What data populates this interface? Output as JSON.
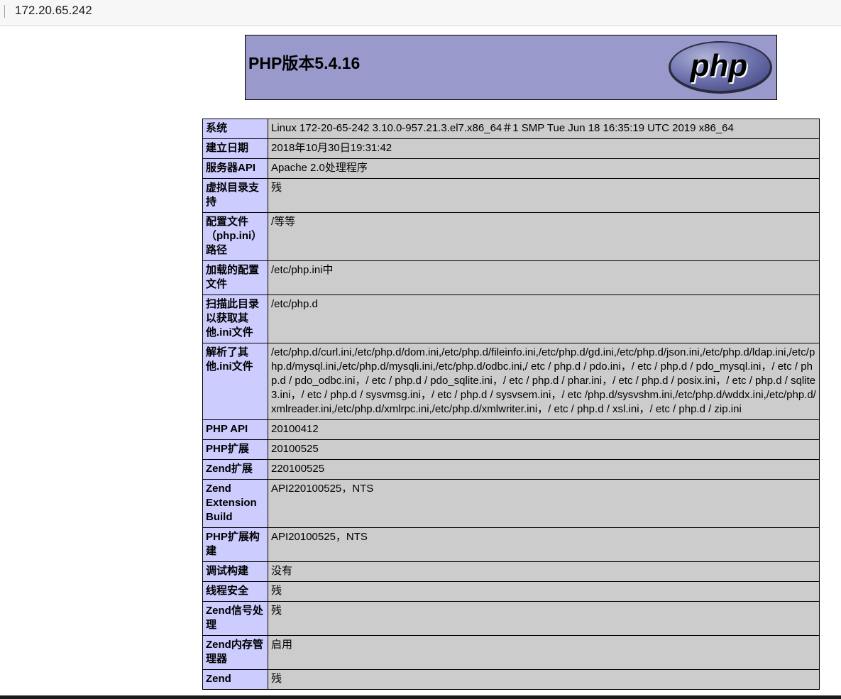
{
  "browser": {
    "url": "172.20.65.242"
  },
  "header": {
    "title": "PHP版本5.4.16",
    "logo_text": "php"
  },
  "rows": [
    {
      "key": "系统",
      "value": "Linux 172-20-65-242 3.10.0-957.21.3.el7.x86_64＃1 SMP Tue Jun 18 16:35:19 UTC 2019 x86_64"
    },
    {
      "key": "建立日期",
      "value": "2018年10月30日19:31:42"
    },
    {
      "key": "服务器API",
      "value": "Apache 2.0处理程序"
    },
    {
      "key": "虚拟目录支持",
      "value": "残"
    },
    {
      "key": "配置文件（php.ini）路径",
      "value": "/等等"
    },
    {
      "key": "加载的配置文件",
      "value": "/etc/php.ini中"
    },
    {
      "key": "扫描此目录以获取其他.ini文件",
      "value": "/etc/php.d"
    },
    {
      "key": "解析了其他.ini文件",
      "value": "/etc/php.d/curl.ini,/etc/php.d/dom.ini,/etc/php.d/fileinfo.ini,/etc/php.d/gd.ini,/etc/php.d/json.ini,/etc/php.d/ldap.ini,/etc/php.d/mysql.ini,/etc/php.d/mysqli.ini,/etc/php.d/odbc.ini,/ etc / php.d / pdo.ini，/ etc / php.d / pdo_mysql.ini，/ etc / php.d / pdo_odbc.ini，/ etc / php.d / pdo_sqlite.ini，/ etc / php.d / phar.ini，/ etc / php.d / posix.ini，/ etc / php.d / sqlite3.ini，/ etc / php.d / sysvmsg.ini，/ etc / php.d / sysvsem.ini，/ etc /php.d/sysvshm.ini,/etc/php.d/wddx.ini,/etc/php.d/xmlreader.ini,/etc/php.d/xmlrpc.ini,/etc/php.d/xmlwriter.ini，/ etc / php.d / xsl.ini，/ etc / php.d / zip.ini"
    },
    {
      "key": "PHP API",
      "value": "20100412"
    },
    {
      "key": "PHP扩展",
      "value": "20100525"
    },
    {
      "key": "Zend扩展",
      "value": "220100525"
    },
    {
      "key": "Zend Extension Build",
      "value": "API220100525，NTS"
    },
    {
      "key": "PHP扩展构建",
      "value": "API20100525，NTS"
    },
    {
      "key": "调试构建",
      "value": "没有"
    },
    {
      "key": "线程安全",
      "value": "残"
    },
    {
      "key": "Zend信号处理",
      "value": "残"
    },
    {
      "key": "Zend内存管理器",
      "value": "启用"
    },
    {
      "key": "Zend",
      "value": "残"
    }
  ],
  "colors": {
    "header_bg": "#9999cc",
    "key_bg": "#ccccff",
    "value_bg": "#cccccc"
  }
}
